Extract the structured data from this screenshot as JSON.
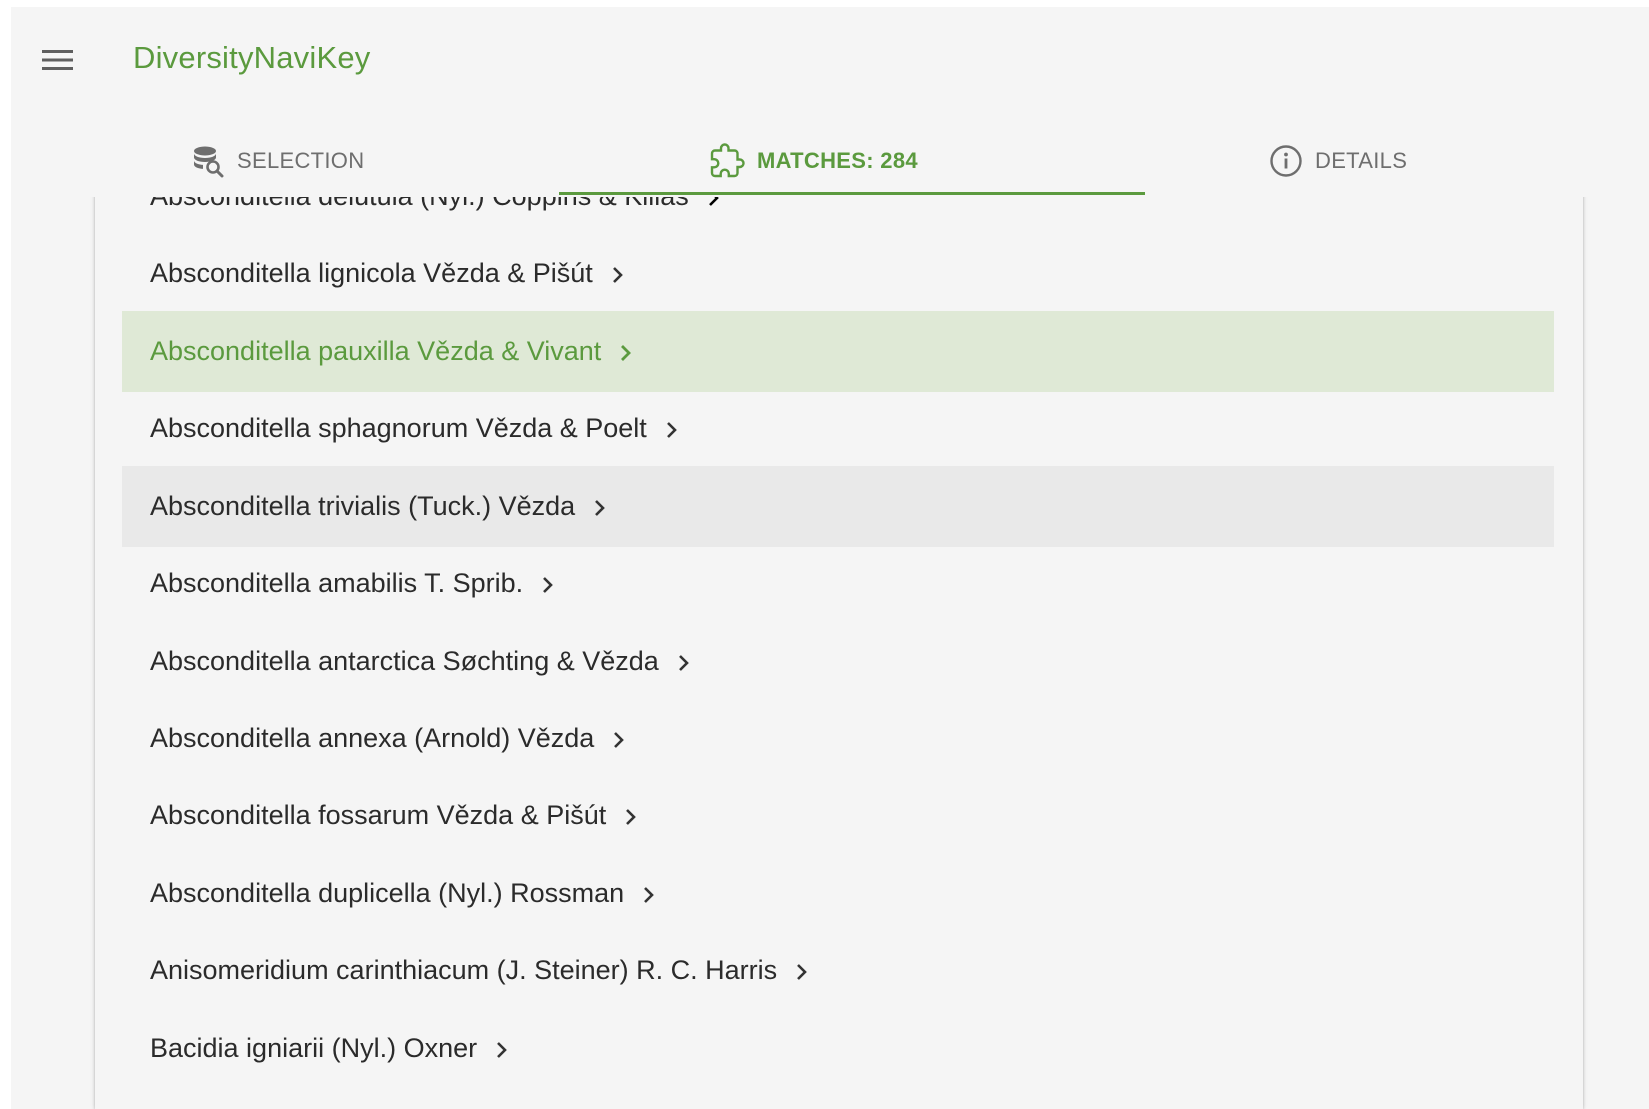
{
  "app": {
    "title": "DiversityNaviKey"
  },
  "colors": {
    "accent": "#5b9a3e",
    "selected_bg": "#dfe9d6",
    "hover_bg": "#e9e9e9",
    "background": "#f5f5f5"
  },
  "tabs": [
    {
      "label": "SELECTION",
      "icon": "database-search-icon",
      "active": false
    },
    {
      "label": "MATCHES: 284",
      "icon": "puzzle-icon",
      "active": true
    },
    {
      "label": "DETAILS",
      "icon": "info-circle-icon",
      "active": false
    }
  ],
  "matches": [
    {
      "name": "Absconditella delutula (Nyl.) Coppins & Kilias",
      "state": "normal"
    },
    {
      "name": "Absconditella lignicola Vězda & Pišút",
      "state": "normal"
    },
    {
      "name": "Absconditella pauxilla Vězda & Vivant",
      "state": "selected"
    },
    {
      "name": "Absconditella sphagnorum Vězda & Poelt",
      "state": "normal"
    },
    {
      "name": "Absconditella trivialis (Tuck.) Vězda",
      "state": "hover"
    },
    {
      "name": "Absconditella amabilis T. Sprib.",
      "state": "normal"
    },
    {
      "name": "Absconditella antarctica Søchting & Vězda",
      "state": "normal"
    },
    {
      "name": "Absconditella annexa (Arnold) Vězda",
      "state": "normal"
    },
    {
      "name": "Absconditella fossarum Vězda & Pišút",
      "state": "normal"
    },
    {
      "name": "Absconditella duplicella (Nyl.) Rossman",
      "state": "normal"
    },
    {
      "name": "Anisomeridium carinthiacum (J. Steiner) R. C. Harris",
      "state": "normal"
    },
    {
      "name": "Bacidia igniarii (Nyl.) Oxner",
      "state": "normal"
    }
  ]
}
